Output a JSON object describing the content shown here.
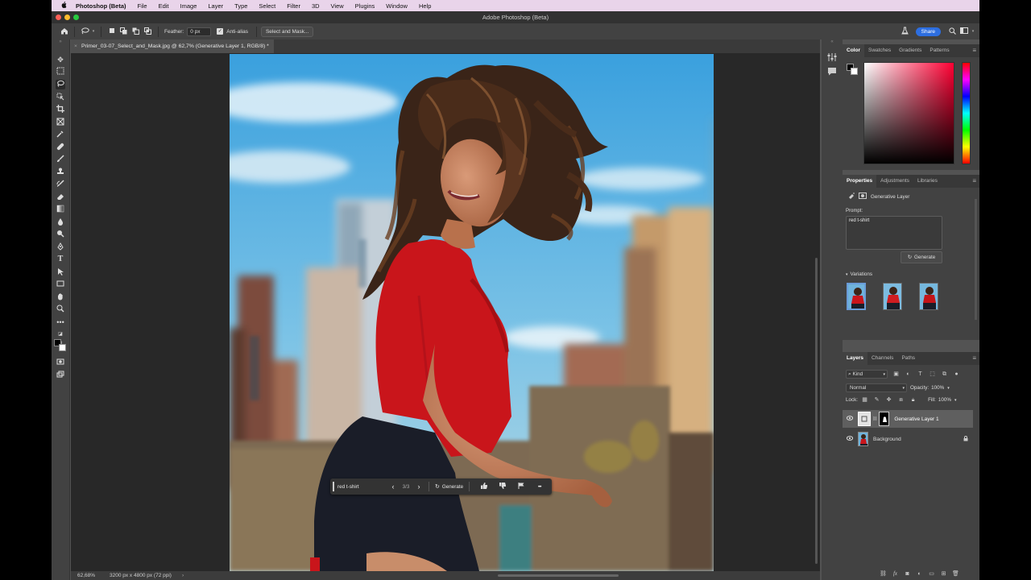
{
  "menubar": {
    "app_name": "Photoshop (Beta)",
    "items": [
      "File",
      "Edit",
      "Image",
      "Layer",
      "Type",
      "Select",
      "Filter",
      "3D",
      "View",
      "Plugins",
      "Window",
      "Help"
    ]
  },
  "window_title": "Adobe Photoshop (Beta)",
  "options": {
    "feather_label": "Feather:",
    "feather_value": "0 px",
    "antialias_label": "Anti-alias",
    "antialias_checked": true,
    "select_mask_label": "Select and Mask...",
    "share_label": "Share"
  },
  "document_tab": "Primer_03-07_Select_and_Mask.jpg @ 62,7% (Generative Layer 1, RGB/8) *",
  "context_bar": {
    "prompt": "red t-shirt",
    "counter": "3/3",
    "generate_label": "Generate"
  },
  "status": {
    "zoom": "62,68%",
    "doc_size": "3200 px x 4800 px (72 ppi)"
  },
  "color_panel": {
    "tabs": [
      "Color",
      "Swatches",
      "Gradients",
      "Patterns"
    ],
    "active_tab": "Color",
    "hue_color": "#ff0033"
  },
  "properties_panel": {
    "tabs": [
      "Properties",
      "Adjustments",
      "Libraries"
    ],
    "active_tab": "Properties",
    "layer_type": "Generative Layer",
    "prompt_label": "Prompt:",
    "prompt_text": "red t-shirt",
    "generate_label": "Generate",
    "variations_label": "Variations",
    "variation_count": 3
  },
  "layers_panel": {
    "tabs": [
      "Layers",
      "Channels",
      "Paths"
    ],
    "active_tab": "Layers",
    "kind_label": "Kind",
    "blend_mode": "Normal",
    "opacity_label": "Opacity:",
    "opacity_value": "100%",
    "lock_label": "Lock:",
    "fill_label": "Fill:",
    "fill_value": "100%",
    "layers": [
      {
        "name": "Generative Layer 1",
        "selected": true
      },
      {
        "name": "Background",
        "locked": true
      }
    ]
  },
  "colors": {
    "accent": "#2d6ee0",
    "menubar_bg": "#e9d4ea",
    "shirt_red": "#c9151b"
  }
}
